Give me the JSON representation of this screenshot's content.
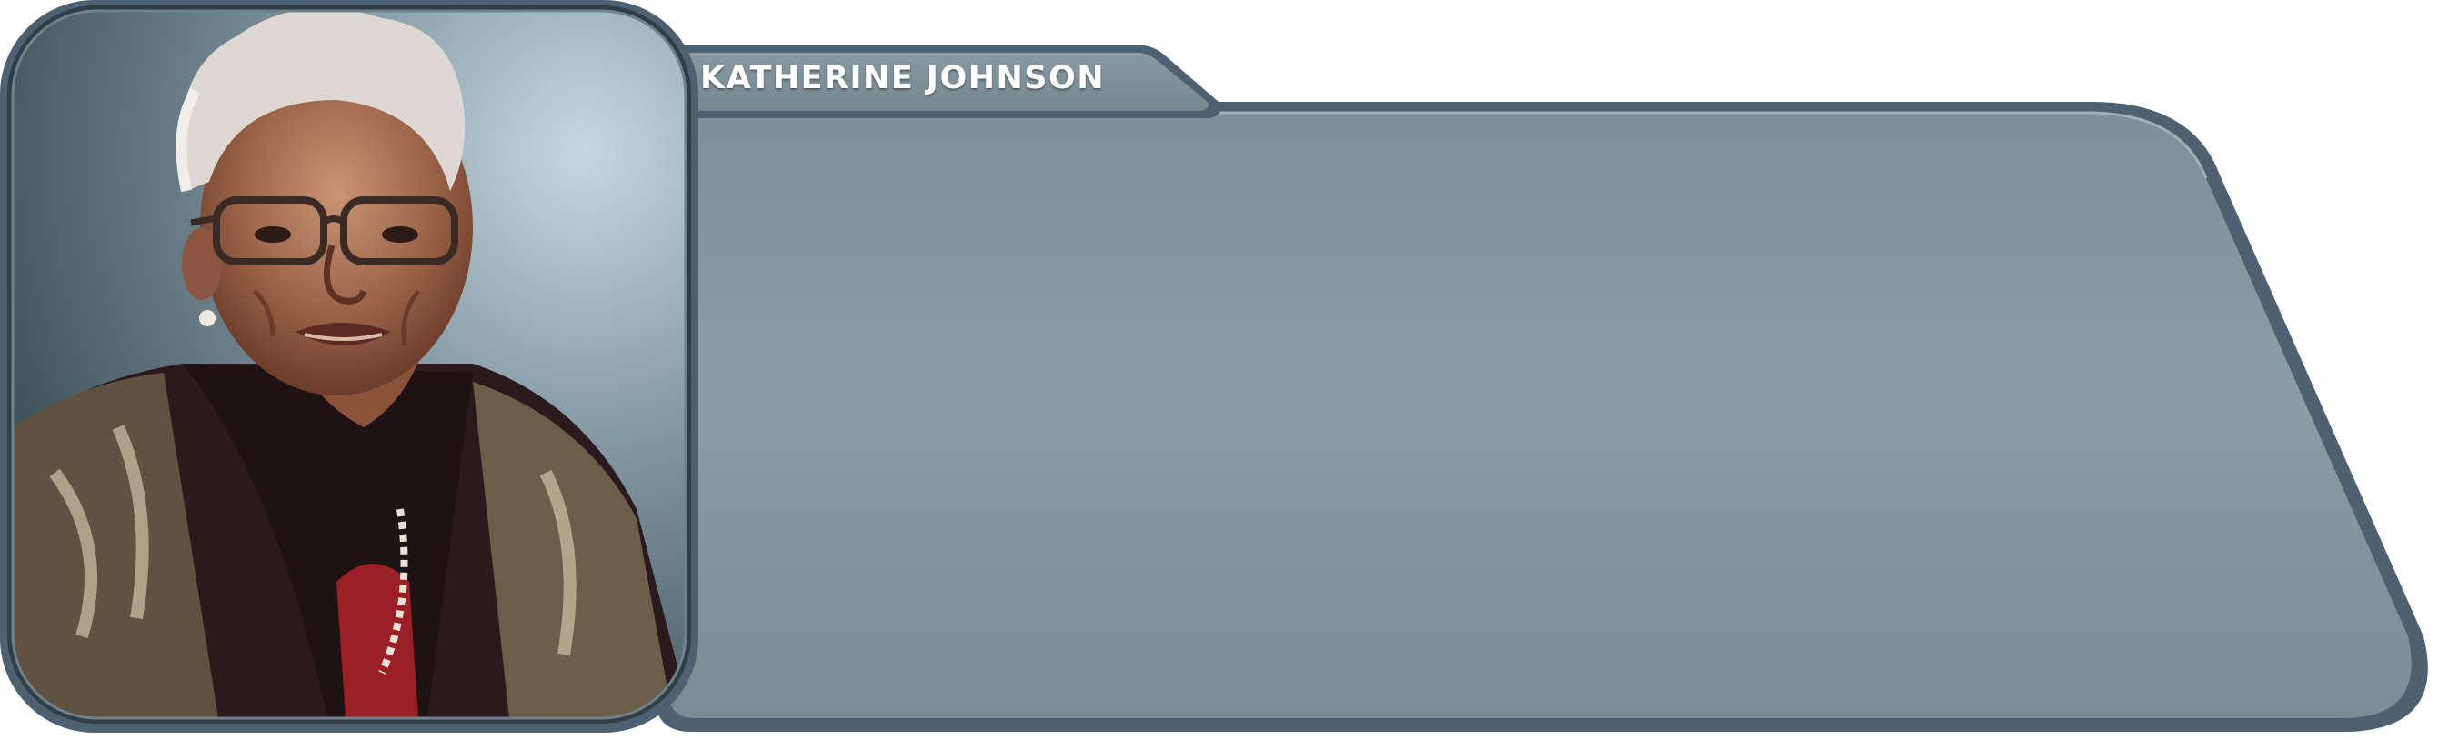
{
  "character": {
    "name": "KATHERINE JOHNSON",
    "portrait_icon": "portrait-icon"
  },
  "dialogue": {
    "text": ""
  },
  "colors": {
    "frame_dark": "#4f636e",
    "panel_fill": "#84979f",
    "panel_fill_light": "#8c9ea6",
    "portrait_bg_light": "#c3d6de",
    "portrait_bg_dark": "#3c4c56",
    "label_text": "#ffffff"
  }
}
